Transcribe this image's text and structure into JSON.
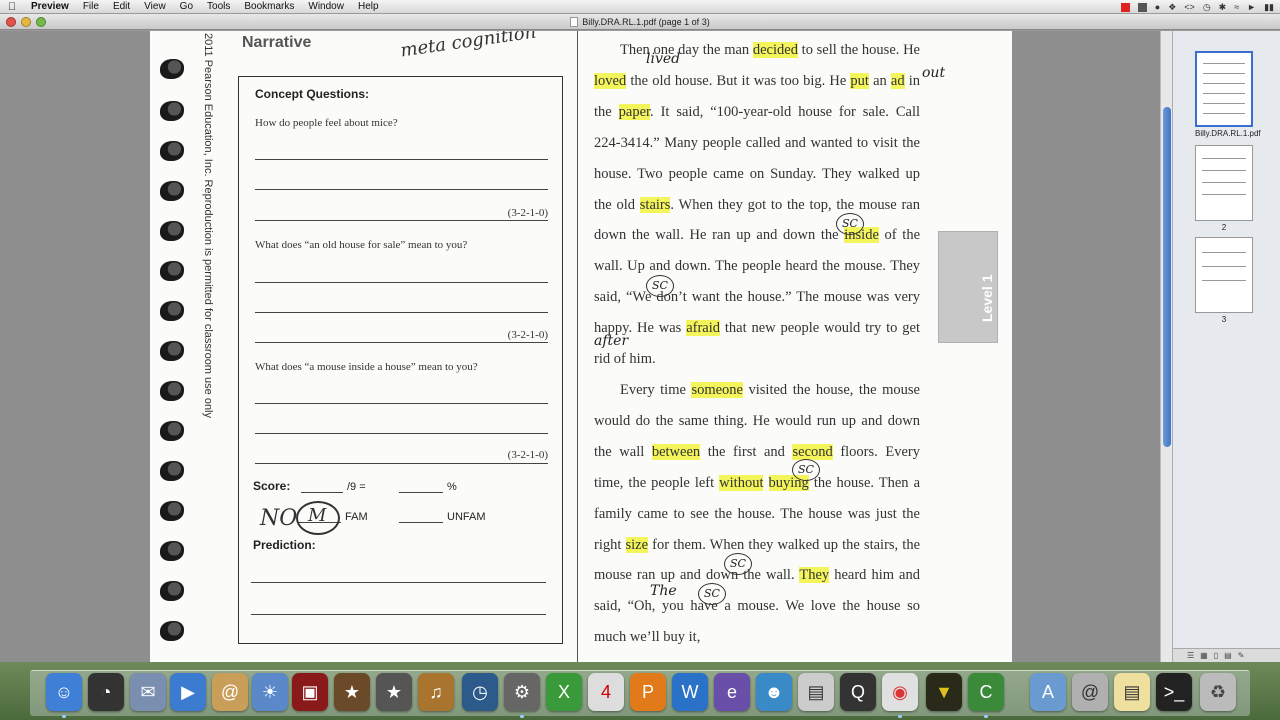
{
  "menubar": {
    "apple": "",
    "items": [
      "Preview",
      "File",
      "Edit",
      "View",
      "Go",
      "Tools",
      "Bookmarks",
      "Window",
      "Help"
    ]
  },
  "window": {
    "title": "Billy.DRA.RL.1.pdf (page 1 of 3)"
  },
  "document": {
    "side_note": "2011 Pearson Education, Inc. Reproduction is permitted for classroom use only",
    "section_title": "Narrative",
    "handwritten_top": "meta cognition",
    "concept": {
      "heading": "Concept Questions:",
      "questions": [
        {
          "text": "How do people feel about mice?",
          "points": "(3-2-1-0)"
        },
        {
          "text": "What does “an old house for sale” mean to you?",
          "points": "(3-2-1-0)"
        },
        {
          "text": "What does “a mouse inside a house” mean to you?",
          "points": "(3-2-1-0)"
        }
      ],
      "score_label": "Score:",
      "score_denom": "/9 =",
      "percent": "%",
      "fam": "FAM",
      "unfam": "UNFAM",
      "prediction_label": "Prediction:",
      "prediction_handwritten": "NO",
      "prediction_circled": "M"
    },
    "level_tab": "Level 1",
    "story": {
      "p1": [
        {
          "t": "Then one day the man ",
          "s": ""
        },
        {
          "t": "decided",
          "s": "hl"
        },
        {
          "t": " to sell the house. He ",
          "s": ""
        },
        {
          "t": "loved",
          "s": "hl"
        },
        {
          "t": " the old house. But it was too big. He ",
          "s": ""
        },
        {
          "t": "put",
          "s": "hl"
        },
        {
          "t": " an ",
          "s": ""
        },
        {
          "t": "ad",
          "s": "hl"
        },
        {
          "t": " in the ",
          "s": ""
        },
        {
          "t": "paper",
          "s": "hl"
        },
        {
          "t": ". It said, “100-year-old house for sale. Call 224-3414.” Many people called and wanted to visit the house. Two people came on Sunday. They walked up the old ",
          "s": ""
        },
        {
          "t": "stairs",
          "s": "hl"
        },
        {
          "t": ". When they got to the top, the mouse ran down the wall. He ran up and down the ",
          "s": ""
        },
        {
          "t": "inside",
          "s": "hl"
        },
        {
          "t": " of the wall. Up and down. The people heard the mouse. They said, “We don’t want the house.” The mouse was very happy. He was ",
          "s": ""
        },
        {
          "t": "afraid",
          "s": "hl"
        },
        {
          "t": " that new people would try to get rid of him.",
          "s": ""
        }
      ],
      "p2": [
        {
          "t": "Every time ",
          "s": ""
        },
        {
          "t": "someone",
          "s": "hl"
        },
        {
          "t": " visited the house, the mouse would do the same thing. He would run up and down the wall ",
          "s": ""
        },
        {
          "t": "between",
          "s": "hl"
        },
        {
          "t": " the first and ",
          "s": ""
        },
        {
          "t": "second",
          "s": "hl"
        },
        {
          "t": " floors. Every time, the people left ",
          "s": ""
        },
        {
          "t": "without",
          "s": "hl"
        },
        {
          "t": " ",
          "s": ""
        },
        {
          "t": "buying",
          "s": "hl"
        },
        {
          "t": " the house. Then a family came to see the house. The house was just the right ",
          "s": ""
        },
        {
          "t": "size",
          "s": "hl"
        },
        {
          "t": " for them. When they walked up the stairs, the mouse ran up and down the wall. ",
          "s": ""
        },
        {
          "t": "They",
          "s": "hl"
        },
        {
          "t": " heard him and said, “Oh, you have a mouse. We love the house so much we’ll buy it,",
          "s": ""
        }
      ],
      "annotations": {
        "lived": "lived",
        "out": "out",
        "after": "after",
        "the": "The",
        "sc": "SC"
      }
    }
  },
  "sidebar": {
    "thumbnails": [
      {
        "caption": "Billy.DRA.RL.1.pdf",
        "selected": true
      },
      {
        "caption": "2",
        "selected": false
      },
      {
        "caption": "3",
        "selected": false
      }
    ]
  },
  "dock": {
    "running_indicator_color": "#99ccff"
  },
  "colors": {
    "highlight": "#f3f55b",
    "selection": "#3b6fcf"
  }
}
